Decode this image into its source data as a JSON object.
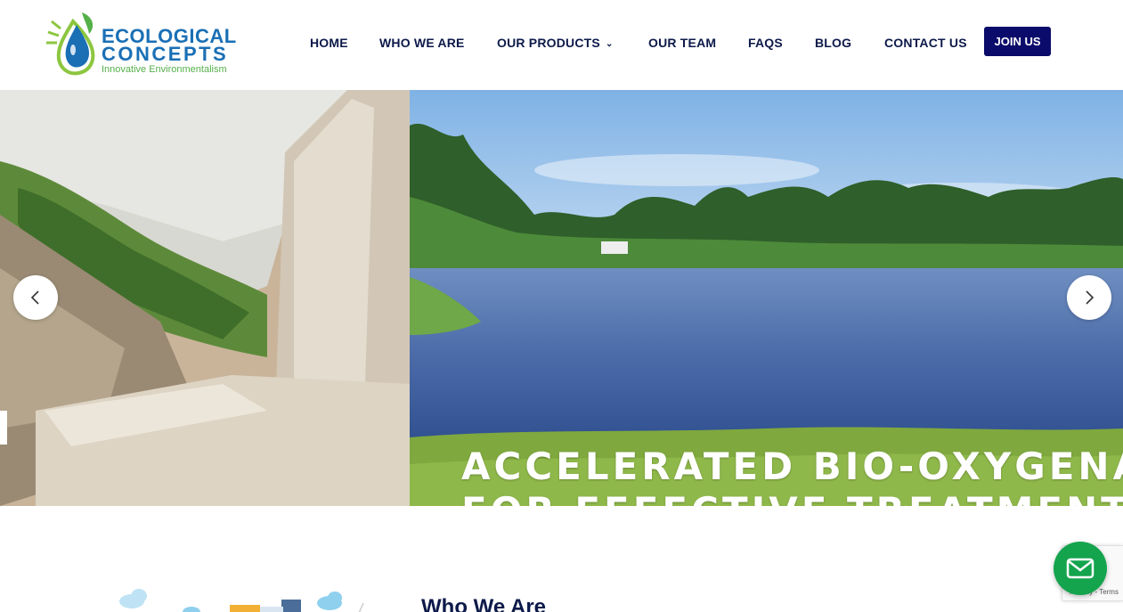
{
  "brand": {
    "line1": "ECOLOGICAL",
    "line2": "CONCEPTS",
    "tagline": "Innovative Environmentalism",
    "colors": {
      "blue": "#1a6fb5",
      "green": "#55b04a",
      "navy": "#0d1a4a"
    }
  },
  "nav": {
    "items": [
      {
        "label": "HOME"
      },
      {
        "label": "WHO WE ARE"
      },
      {
        "label": "OUR PRODUCTS",
        "has_dropdown": true,
        "icon": "chevron-down-icon"
      },
      {
        "label": "OUR TEAM"
      },
      {
        "label": "FAQS"
      },
      {
        "label": "BLOG"
      },
      {
        "label": "CONTACT US"
      }
    ],
    "join_label": "JOIN US",
    "join_color": "#0b0b6b"
  },
  "hero": {
    "heading_line1": "ACCELERATED BIO-OXYGENATIO",
    "heading_line2": "FOR EFFECTIVE TREATMENT OF P",
    "prev_icon": "chevron-left-icon",
    "next_icon": "chevron-right-icon"
  },
  "section": {
    "title": "Who We Are"
  },
  "recaptcha": {
    "links": "Privacy - Terms"
  },
  "contact_fab": {
    "icon": "mail-icon",
    "color": "#14a44d"
  }
}
